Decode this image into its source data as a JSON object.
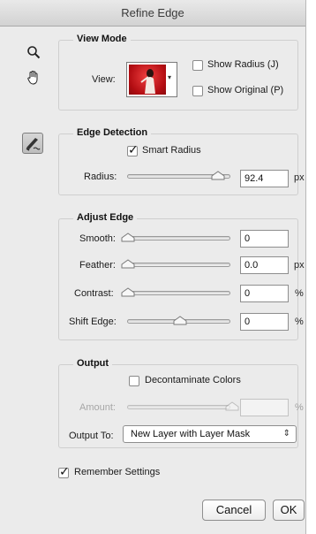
{
  "window": {
    "title": "Refine Edge"
  },
  "tools": {
    "zoom": "zoom-icon",
    "hand": "hand-icon",
    "refine_brush": "refine-radius-brush-icon"
  },
  "view_mode": {
    "legend": "View Mode",
    "view_label": "View:",
    "show_radius": {
      "label": "Show Radius (J)",
      "checked": false
    },
    "show_original": {
      "label": "Show Original (P)",
      "checked": false
    }
  },
  "edge_detection": {
    "legend": "Edge Detection",
    "smart_radius": {
      "label": "Smart Radius",
      "checked": true
    },
    "radius": {
      "label": "Radius:",
      "value": "92.4",
      "unit": "px",
      "level": 0.92
    }
  },
  "adjust_edge": {
    "legend": "Adjust Edge",
    "smooth": {
      "label": "Smooth:",
      "value": "0",
      "unit": "",
      "level": 0
    },
    "feather": {
      "label": "Feather:",
      "value": "0.0",
      "unit": "px",
      "level": 0
    },
    "contrast": {
      "label": "Contrast:",
      "value": "0",
      "unit": "%",
      "level": 0
    },
    "shift_edge": {
      "label": "Shift Edge:",
      "value": "0",
      "unit": "%",
      "level": 0.5
    }
  },
  "output": {
    "legend": "Output",
    "decontaminate": {
      "label": "Decontaminate Colors",
      "checked": false
    },
    "amount": {
      "label": "Amount:",
      "value": "",
      "unit": "%"
    },
    "output_to": {
      "label": "Output To:",
      "selected": "New Layer with Layer Mask"
    }
  },
  "remember": {
    "label": "Remember Settings",
    "checked": true
  },
  "buttons": {
    "cancel": "Cancel",
    "ok": "OK"
  },
  "colors": {
    "preview_red": "#c8141b",
    "accent": "#3b76d6"
  }
}
